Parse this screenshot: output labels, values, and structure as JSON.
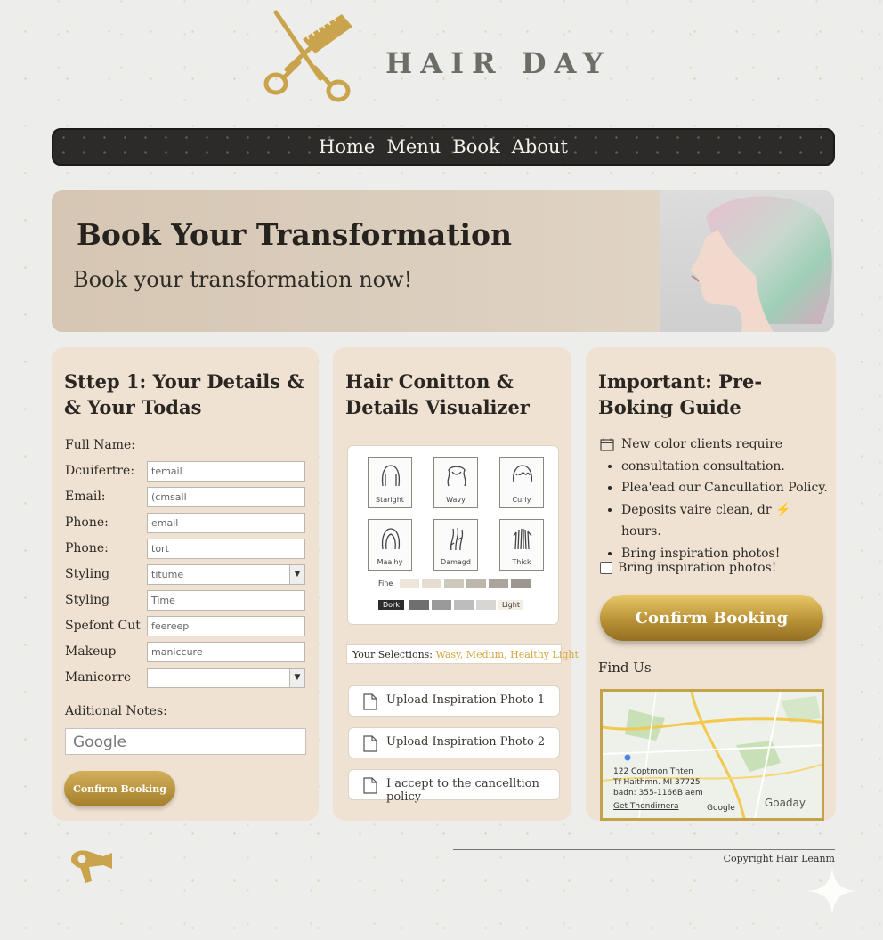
{
  "brand": {
    "name": "HAIR DAY"
  },
  "nav": {
    "items": [
      "Home",
      "Menu",
      "Book",
      "About"
    ]
  },
  "hero": {
    "title": "Book Your Transformation",
    "subtitle": "Book your transformation now!"
  },
  "form": {
    "title": "Sttep 1: Your Details & & Your Todas",
    "fullname_label": "Full Name:",
    "fields": [
      {
        "label": "Dcuifertre:",
        "value": "temail",
        "type": "text"
      },
      {
        "label": "Email:",
        "value": "(cmsall",
        "type": "text"
      },
      {
        "label": "Phone:",
        "value": "email",
        "type": "text"
      },
      {
        "label": "Phone:",
        "value": "tort",
        "type": "text"
      },
      {
        "label": "Styling",
        "value": "titume",
        "type": "select"
      },
      {
        "label": "Styling",
        "value": "Time",
        "type": "text"
      },
      {
        "label": "Spefont Cut",
        "value": "feereep",
        "type": "text"
      },
      {
        "label": "Makeup",
        "value": "maniccure",
        "type": "text"
      },
      {
        "label": "Manicorre",
        "value": "",
        "type": "select"
      }
    ],
    "notes_label": "Aditional Notes:",
    "notes_value": "Google",
    "confirm_label": "Confirm Booking"
  },
  "visualizer": {
    "title": "Hair Conitton & Details Visualizer",
    "tiles": [
      {
        "label": "Staright"
      },
      {
        "label": "Wavy"
      },
      {
        "label": "Curly"
      },
      {
        "label": "Maaihy"
      },
      {
        "label": "Damagd"
      },
      {
        "label": "Thick"
      }
    ],
    "scale1_label": "Fine",
    "scale2_start": "Dork",
    "scale2_end": "Light",
    "selections_label": "Your Selections:",
    "selections_value": "Wasy, Medum, Healthy Light",
    "uploads": [
      "Upload Inspiration Photo 1",
      "Upload Inspiration Photo 2",
      "I accept to the cancelltion policy"
    ]
  },
  "guide": {
    "title": "Important: Pre-Boking Guide",
    "first_item": "New color clients require",
    "items": [
      "consultation consultation.",
      "Plea'ead our Cancullation Policy.",
      "Deposits vaire clean, dr ⚡ hours.",
      "Bring inspiration photos!"
    ],
    "checkbox_label": "Bring inspiration photos!",
    "confirm_label": "Confirm Booking",
    "findus_label": "Find Us",
    "map": {
      "addr1": "122 Coptmon Tnten",
      "addr2": "Tf Haithmn. MI 37725",
      "addr3": "badn: 355-1166B aem",
      "directions": "Get Thondirnera",
      "google_mark": "Google",
      "brand_mark": "Goaday"
    }
  },
  "footer": {
    "copyright": "Copyright Hair Leanm"
  },
  "colors": {
    "gold": "#c4a24b",
    "nav_bg": "#2c2b29",
    "card_bg": "#efe2d2",
    "page_bg": "#ededec"
  }
}
